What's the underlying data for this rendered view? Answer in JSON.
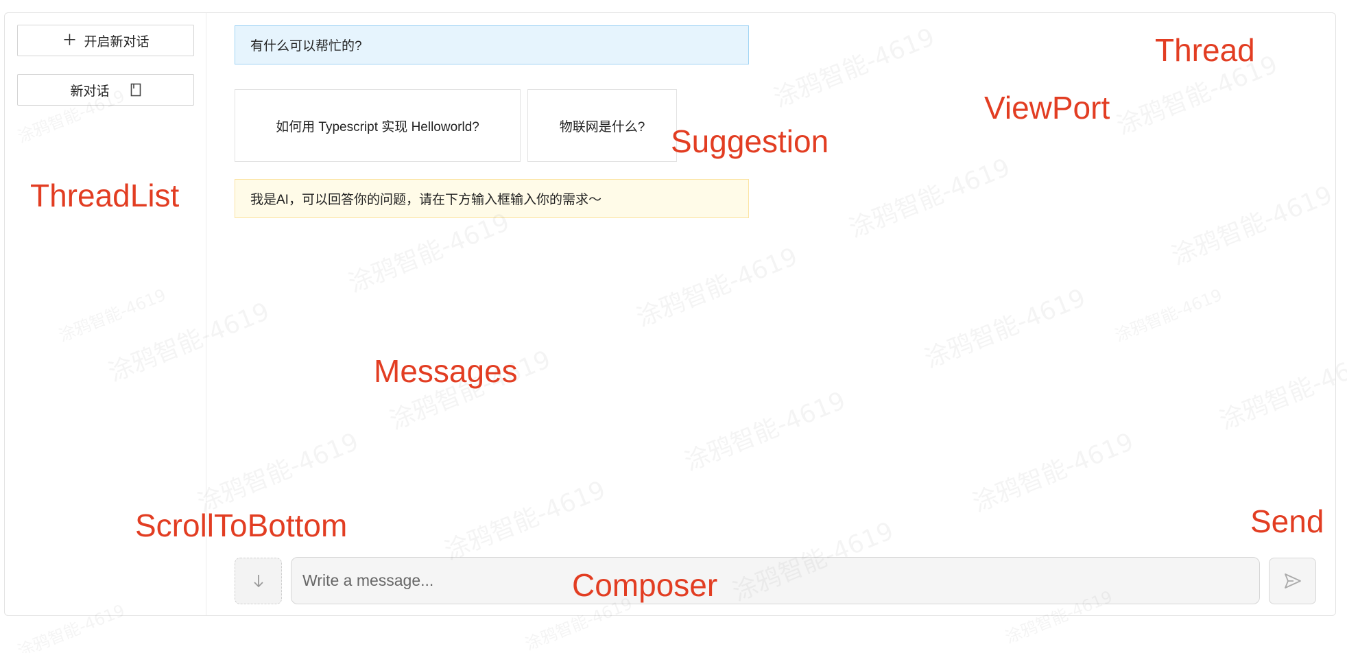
{
  "sidebar": {
    "new_chat_label": "开启新对话",
    "thread_label": "新对话"
  },
  "messages": {
    "user": "有什么可以帮忙的?",
    "suggestions": [
      "如何用 Typescript 实现 Helloworld?",
      "物联网是什么?"
    ],
    "ai": "我是AI，可以回答你的问题，请在下方输入框输入你的需求～"
  },
  "composer": {
    "placeholder": "Write a message..."
  },
  "annotations": {
    "thread": "Thread",
    "viewport": "ViewPort",
    "suggestion": "Suggestion",
    "threadlist": "ThreadList",
    "messages": "Messages",
    "scroll_to_bottom": "ScrollToBottom",
    "send": "Send",
    "composer": "Composer"
  },
  "watermark": "涂鸦智能-4619",
  "colors": {
    "annotation": "#e23d22",
    "user_bubble_bg": "#e6f4fd",
    "user_bubble_border": "#9fd3f4",
    "ai_bubble_bg": "#fffbe8",
    "ai_bubble_border": "#fbe3a2"
  },
  "icons": {
    "new_chat": "plus-icon",
    "thread": "document-icon",
    "scroll_to_bottom": "arrow-down-icon",
    "send": "send-icon"
  }
}
